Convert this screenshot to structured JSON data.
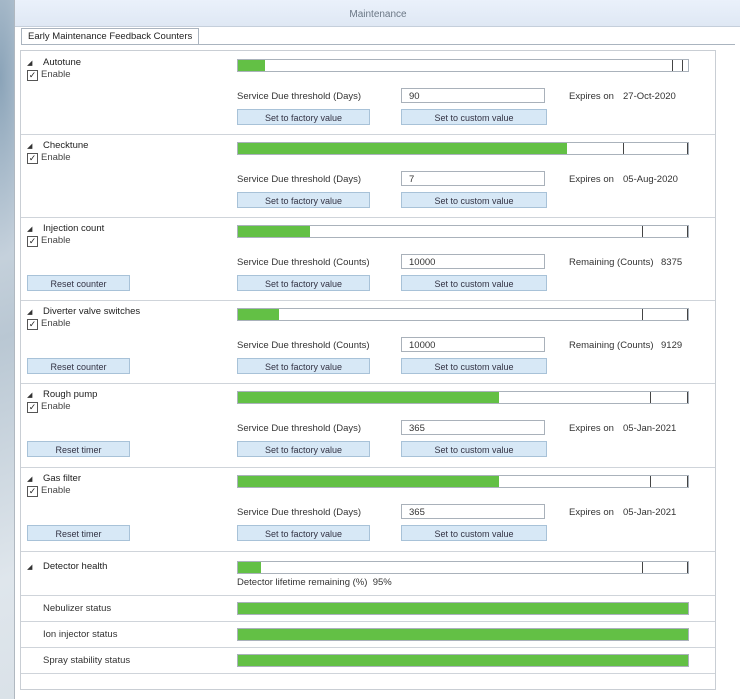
{
  "window": {
    "title": "Maintenance"
  },
  "tabs": [
    {
      "label": "Early Maintenance Feedback Counters"
    }
  ],
  "colors": {
    "progress_fill": "#63c045",
    "button_bg": "#d7e8f6"
  },
  "sections": [
    {
      "name": "Autotune",
      "enable_label": "Enable",
      "enabled": true,
      "progress": 0.06,
      "threshold_label": "Service Due threshold  (Days)",
      "threshold_value": "90",
      "status_label": "Expires on",
      "status_value": "27-Oct-2020",
      "factory_label": "Set to factory value",
      "custom_label": "Set to custom value"
    },
    {
      "name": "Checktune",
      "enable_label": "Enable",
      "enabled": true,
      "progress": 0.73,
      "threshold_label": "Service Due threshold  (Days)",
      "threshold_value": "7",
      "status_label": "Expires on",
      "status_value": "05-Aug-2020",
      "factory_label": "Set to factory value",
      "custom_label": "Set to custom value"
    },
    {
      "name": "Injection count",
      "enable_label": "Enable",
      "enabled": true,
      "progress": 0.16,
      "threshold_label": "Service Due threshold  (Counts)",
      "threshold_value": "10000",
      "status_label": "Remaining (Counts)",
      "status_value": "8375",
      "factory_label": "Set to factory value",
      "custom_label": "Set to custom value",
      "reset_label": "Reset counter"
    },
    {
      "name": "Diverter valve switches",
      "enable_label": "Enable",
      "enabled": true,
      "progress": 0.09,
      "threshold_label": "Service Due threshold  (Counts)",
      "threshold_value": "10000",
      "status_label": "Remaining (Counts)",
      "status_value": "9129",
      "factory_label": "Set to factory value",
      "custom_label": "Set to custom value",
      "reset_label": "Reset counter"
    },
    {
      "name": "Rough pump",
      "enable_label": "Enable",
      "enabled": true,
      "progress": 0.58,
      "threshold_label": "Service Due threshold  (Days)",
      "threshold_value": "365",
      "status_label": "Expires on",
      "status_value": "05-Jan-2021",
      "factory_label": "Set to factory value",
      "custom_label": "Set to custom value",
      "reset_label": "Reset timer"
    },
    {
      "name": "Gas filter",
      "enable_label": "Enable",
      "enabled": true,
      "progress": 0.58,
      "threshold_label": "Service Due threshold  (Days)",
      "threshold_value": "365",
      "status_label": "Expires on",
      "status_value": "05-Jan-2021",
      "factory_label": "Set to factory value",
      "custom_label": "Set to custom value",
      "reset_label": "Reset timer"
    }
  ],
  "detector": {
    "name": "Detector health",
    "progress": 0.05,
    "remaining_label": "Detector lifetime remaining (%)",
    "remaining_value": "95%"
  },
  "statuses": [
    {
      "label": "Nebulizer status",
      "progress": 1.0
    },
    {
      "label": "Ion injector status",
      "progress": 1.0
    },
    {
      "label": "Spray stability status",
      "progress": 1.0
    }
  ]
}
